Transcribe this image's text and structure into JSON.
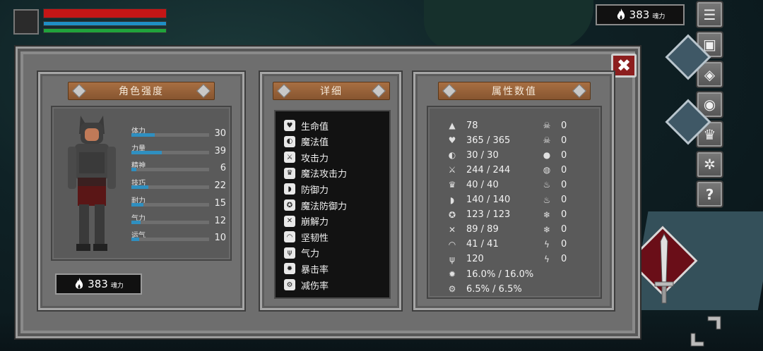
{
  "currency": {
    "value": "383",
    "unit": "魂力"
  },
  "panels": {
    "character_title": "角色强度",
    "details_title": "详细",
    "attributes_title": "属性数值"
  },
  "hud": {
    "hp_fraction": 1.0,
    "mp_fraction": 1.0,
    "stamina_fraction": 1.0
  },
  "stats": [
    {
      "label": "体力",
      "value": "30",
      "fill": 0.3
    },
    {
      "label": "力量",
      "value": "39",
      "fill": 0.39
    },
    {
      "label": "精神",
      "value": "6",
      "fill": 0.06
    },
    {
      "label": "技巧",
      "value": "22",
      "fill": 0.22
    },
    {
      "label": "耐力",
      "value": "15",
      "fill": 0.15
    },
    {
      "label": "气力",
      "value": "12",
      "fill": 0.12
    },
    {
      "label": "运气",
      "value": "10",
      "fill": 0.1
    }
  ],
  "details": [
    {
      "label": "生命值",
      "icon": "heart-icon"
    },
    {
      "label": "魔法值",
      "icon": "brain-icon"
    },
    {
      "label": "攻击力",
      "icon": "sword-icon"
    },
    {
      "label": "魔法攻击力",
      "icon": "magic-crown-icon"
    },
    {
      "label": "防御力",
      "icon": "shield-icon"
    },
    {
      "label": "魔法防御力",
      "icon": "magic-shield-icon"
    },
    {
      "label": "崩解力",
      "icon": "crossed-swords-icon"
    },
    {
      "label": "坚韧性",
      "icon": "helmet-icon"
    },
    {
      "label": "气力",
      "icon": "lungs-icon"
    },
    {
      "label": "暴击率",
      "icon": "burst-icon"
    },
    {
      "label": "减伤率",
      "icon": "gear-shield-icon"
    }
  ],
  "attributes_left": [
    {
      "icon": "armor-icon",
      "value": "78"
    },
    {
      "icon": "heart-icon",
      "value": "365 / 365"
    },
    {
      "icon": "brain-icon",
      "value": "30 / 30"
    },
    {
      "icon": "sword-icon",
      "value": "244 / 244"
    },
    {
      "icon": "magic-crown-icon",
      "value": "40 / 40"
    },
    {
      "icon": "shield-icon",
      "value": "140 / 140"
    },
    {
      "icon": "magic-shield-icon",
      "value": "123 / 123"
    },
    {
      "icon": "crossed-swords-icon",
      "value": "89 / 89"
    },
    {
      "icon": "helmet-icon",
      "value": "41 / 41"
    },
    {
      "icon": "lungs-icon",
      "value": "120"
    },
    {
      "icon": "burst-icon",
      "value": "16.0% / 16.0%"
    },
    {
      "icon": "gear-shield-icon",
      "value": "6.5% / 6.5%"
    }
  ],
  "attributes_right": [
    {
      "icon": "skull-icon",
      "value": "0"
    },
    {
      "icon": "skull-crossbones-icon",
      "value": "0"
    },
    {
      "icon": "drop-icon",
      "value": "0"
    },
    {
      "icon": "bleed-icon",
      "value": "0"
    },
    {
      "icon": "fire-icon",
      "value": "0"
    },
    {
      "icon": "fire-resist-icon",
      "value": "0"
    },
    {
      "icon": "snowflake-icon",
      "value": "0"
    },
    {
      "icon": "snowflake-resist-icon",
      "value": "0"
    },
    {
      "icon": "lightning-icon",
      "value": "0"
    },
    {
      "icon": "lightning-resist-icon",
      "value": "0"
    }
  ],
  "side_menu": [
    {
      "icon": "list-menu-icon",
      "glyph": "☰"
    },
    {
      "icon": "backpack-icon",
      "glyph": "▣"
    },
    {
      "icon": "helmet-equip-icon",
      "glyph": "◈"
    },
    {
      "icon": "skill-orb-icon",
      "glyph": "◉"
    },
    {
      "icon": "crown-icon",
      "glyph": "♛"
    },
    {
      "icon": "settings-gear-icon",
      "glyph": "✲"
    },
    {
      "icon": "help-icon",
      "glyph": "?"
    }
  ],
  "colors": {
    "hp": "#c41616",
    "mp": "#1f8fc4",
    "stamina": "#20a33c",
    "stat_bar": "#2f8fc0",
    "close_button": "#8c1e1e"
  }
}
